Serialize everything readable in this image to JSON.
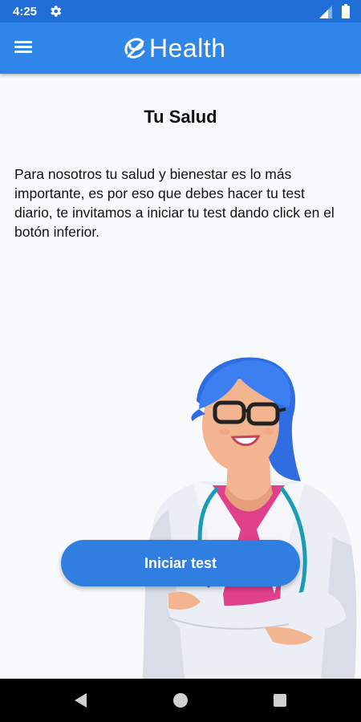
{
  "status_bar": {
    "time": "4:25",
    "icons": [
      "settings-gear-icon",
      "cell-signal-icon",
      "battery-icon"
    ]
  },
  "app_bar": {
    "menu_icon": "hamburger-menu-icon",
    "brand_name": "Health",
    "brand_color": "#2f86e8"
  },
  "main": {
    "title": "Tu Salud",
    "intro": "Para nosotros tu salud y bienestar es lo más importante, es por eso que debes hacer tu test diario, te invitamos a iniciar tu test dando click en el botón inferior.",
    "illustration": "doctor-illustration"
  },
  "cta": {
    "label": "Iniciar test",
    "color": "#2f7ee0"
  },
  "nav_bar": {
    "buttons": [
      "back-icon",
      "home-icon",
      "recents-icon"
    ]
  }
}
